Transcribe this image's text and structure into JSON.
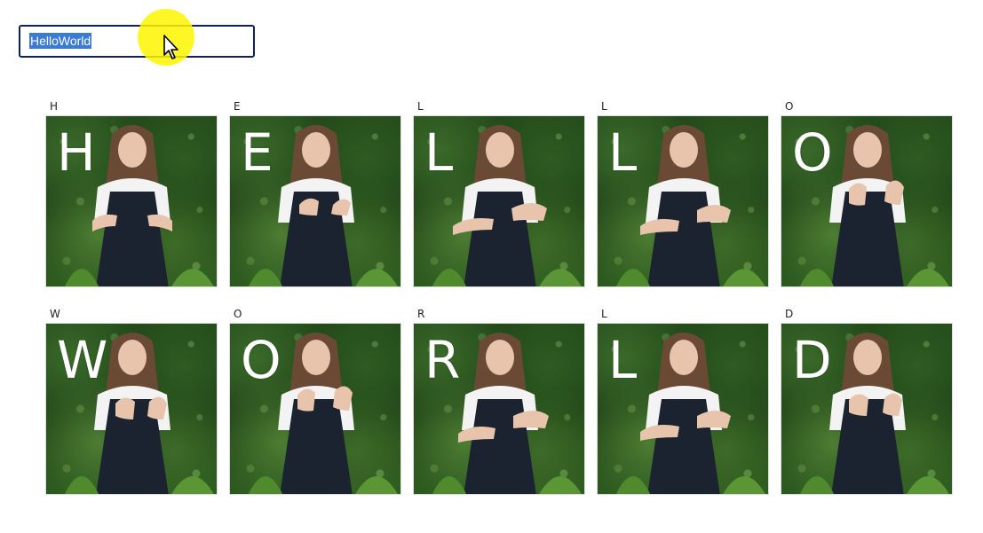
{
  "input": {
    "value": "HelloWorld"
  },
  "signs": {
    "row1": [
      {
        "label": "H",
        "letter": "H"
      },
      {
        "label": "E",
        "letter": "E"
      },
      {
        "label": "L",
        "letter": "L"
      },
      {
        "label": "L",
        "letter": "L"
      },
      {
        "label": "O",
        "letter": "O"
      }
    ],
    "row2": [
      {
        "label": "W",
        "letter": "W"
      },
      {
        "label": "O",
        "letter": "O"
      },
      {
        "label": "R",
        "letter": "R"
      },
      {
        "label": "L",
        "letter": "L"
      },
      {
        "label": "D",
        "letter": "D"
      }
    ]
  },
  "colors": {
    "input_border": "#0b1f6b",
    "selection": "#3a7bd5",
    "cursor_highlight": "#fff500"
  },
  "icons": {
    "cursor": "mouse-pointer-icon"
  }
}
